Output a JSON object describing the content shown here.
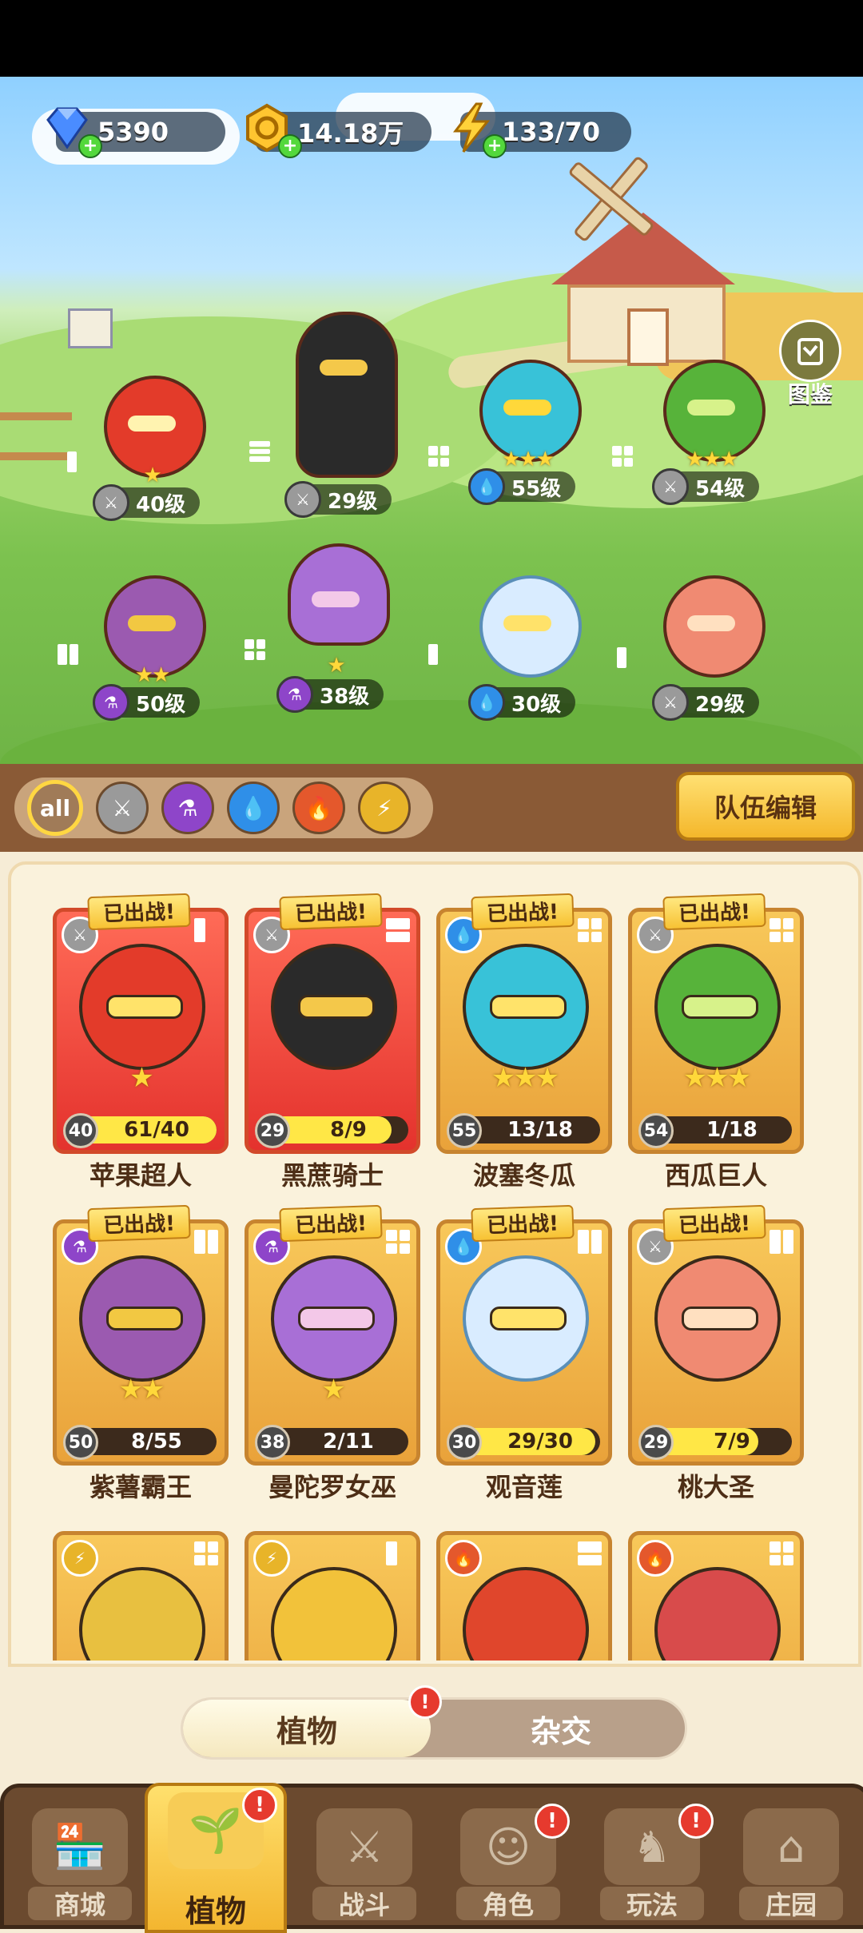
{
  "resources": {
    "gems": "5390",
    "coins": "14.18万",
    "energy": "133/70"
  },
  "atlas_label": "图鉴",
  "stage": [
    {
      "level": "40级",
      "stars": "★",
      "element": "sword",
      "color": "#e33b2a"
    },
    {
      "level": "29级",
      "stars": "",
      "element": "sword",
      "color": "#2a2a2a"
    },
    {
      "level": "55级",
      "stars": "★★★",
      "element": "water",
      "color": "#38c2d8"
    },
    {
      "level": "54级",
      "stars": "★★★",
      "element": "sword",
      "color": "#57b33a"
    },
    {
      "level": "50级",
      "stars": "★★",
      "element": "potion",
      "color": "#9b5ab0"
    },
    {
      "level": "38级",
      "stars": "★",
      "element": "potion",
      "color": "#a86fd6"
    },
    {
      "level": "30级",
      "stars": "",
      "element": "water",
      "color": "#d9ecff"
    },
    {
      "level": "29级",
      "stars": "",
      "element": "sword",
      "color": "#f08a72"
    }
  ],
  "filters": {
    "all": "all"
  },
  "team_edit": "队伍编辑",
  "deployed_tag": "已出战!",
  "cards": [
    {
      "name": "苹果超人",
      "level": "40",
      "progress": "61/40",
      "fill": 1.0,
      "stars": "★",
      "element": "sword",
      "style": "red",
      "color": "#e33b2a"
    },
    {
      "name": "黑蔗骑士",
      "level": "29",
      "progress": "8/9",
      "fill": 0.89,
      "stars": "",
      "element": "sword",
      "style": "red",
      "color": "#2a2a2a"
    },
    {
      "name": "波塞冬瓜",
      "level": "55",
      "progress": "13/18",
      "fill": 0.0,
      "stars": "★★★",
      "element": "water",
      "style": "gold",
      "color": "#38c2d8"
    },
    {
      "name": "西瓜巨人",
      "level": "54",
      "progress": "1/18",
      "fill": 0.0,
      "stars": "★★★",
      "element": "sword",
      "style": "gold",
      "color": "#57b33a"
    },
    {
      "name": "紫薯霸王",
      "level": "50",
      "progress": "8/55",
      "fill": 0.15,
      "stars": "★★",
      "element": "potion",
      "style": "gold",
      "color": "#9b5ab0"
    },
    {
      "name": "曼陀罗女巫",
      "level": "38",
      "progress": "2/11",
      "fill": 0.18,
      "stars": "★",
      "element": "potion",
      "style": "gold",
      "color": "#a86fd6"
    },
    {
      "name": "观音莲",
      "level": "30",
      "progress": "29/30",
      "fill": 0.97,
      "stars": "",
      "element": "water",
      "style": "gold",
      "color": "#d9ecff"
    },
    {
      "name": "桃大圣",
      "level": "29",
      "progress": "7/9",
      "fill": 0.78,
      "stars": "",
      "element": "sword",
      "style": "gold",
      "color": "#f08a72"
    }
  ],
  "partial_cards": [
    {
      "element": "lightning",
      "color": "#e8c040"
    },
    {
      "element": "lightning",
      "color": "#f2c23a"
    },
    {
      "element": "fire",
      "color": "#e0462c"
    },
    {
      "element": "fire",
      "color": "#d84b4b"
    }
  ],
  "toggle": {
    "left": "植物",
    "right": "杂交"
  },
  "nav": [
    {
      "label": "商城"
    },
    {
      "label": "植物"
    },
    {
      "label": "战斗"
    },
    {
      "label": "角色"
    },
    {
      "label": "玩法"
    },
    {
      "label": "庄园"
    }
  ],
  "alert_mark": "!"
}
